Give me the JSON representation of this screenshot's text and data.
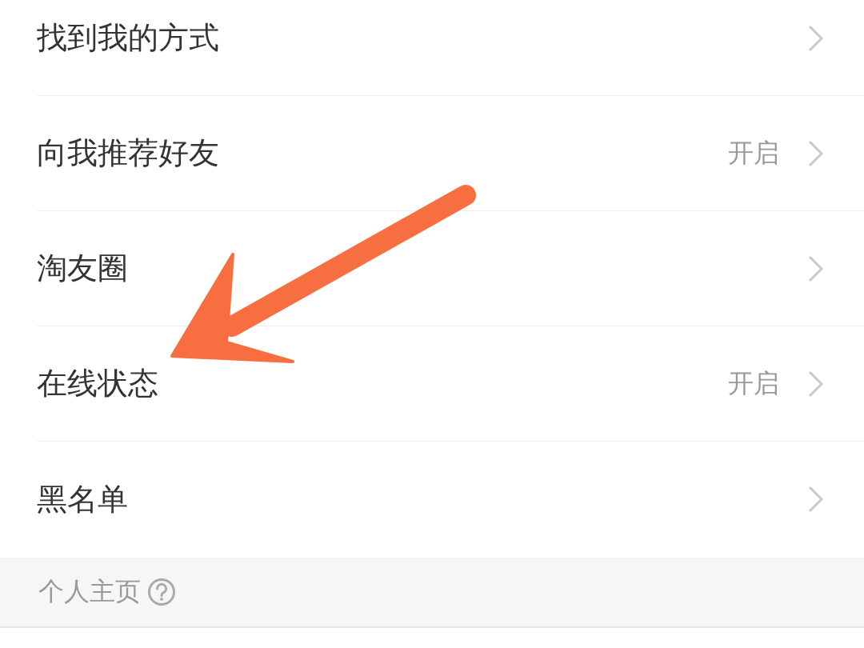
{
  "settings": [
    {
      "label": "找到我的方式"
    },
    {
      "label": "向我推荐好友",
      "value": "开启"
    },
    {
      "label": "淘友圈"
    },
    {
      "label": "在线状态",
      "value": "开启"
    },
    {
      "label": "黑名单"
    }
  ],
  "section": {
    "title": "个人主页"
  },
  "annotation": {
    "kind": "arrow"
  }
}
